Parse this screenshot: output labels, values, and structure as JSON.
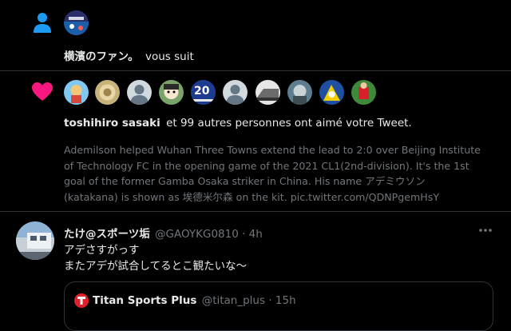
{
  "follow_notification": {
    "icon": "person-icon",
    "user_name": "横濱のファン。",
    "action_text": "vous suit"
  },
  "like_notification": {
    "icon": "heart-icon",
    "icon_color": "#f91880",
    "liker_name": "toshihiro sasaki",
    "rest_text": "et 99 autres personnes ont aimé votre Tweet.",
    "badge_number": "20",
    "tweet_text": [
      "Ademilson helped Wuhan Three Towns extend the lead to 2:0 over Beijing Institute",
      "of Technology FC in the opening game of the 2021 CL1(2nd-division). It's the 1st",
      "goal of the former Gamba Osaka striker in China. His name アデミウソン",
      "(katakana) is shown as 埃德米尔森 on the kit. pic.twitter.com/QDNPgemHsY"
    ]
  },
  "reply_tweet": {
    "display_name": "たけ@スポーツ垢",
    "handle": "@GAOYKG0810",
    "time": "· 4h",
    "more_icon": "more-dots-icon",
    "lines": [
      "アデさすがっす",
      "またアデが試合してるとこ観たいな〜"
    ],
    "quoted": {
      "display_name": "Titan Sports Plus",
      "handle": "@titan_plus",
      "time": "· 15h"
    }
  },
  "colors": {
    "background": "#000000",
    "text": "#e7e9ea",
    "secondary": "#71767b",
    "accent": "#1d9bf0",
    "like": "#f91880",
    "divider": "#2f3336"
  }
}
